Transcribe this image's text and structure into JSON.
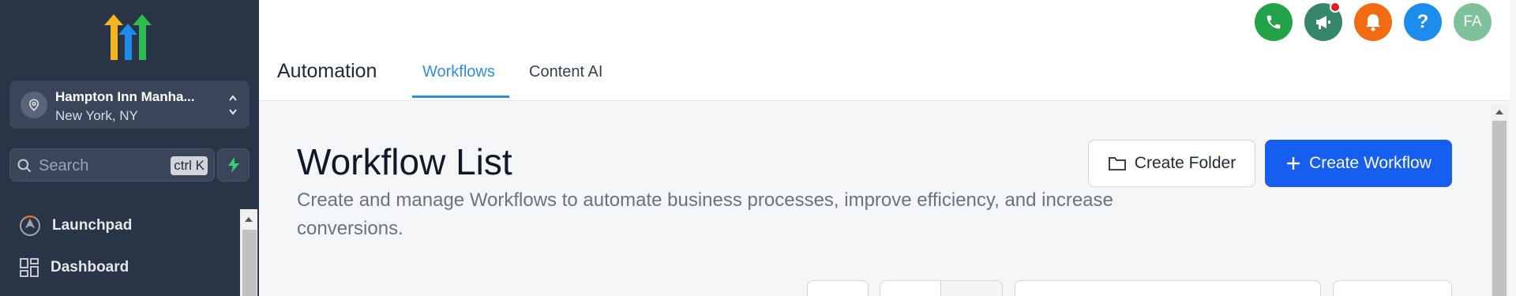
{
  "sidebar": {
    "location": {
      "name": "Hampton Inn Manha...",
      "city": "New York, NY"
    },
    "search": {
      "placeholder": "Search",
      "shortcut": "ctrl K"
    },
    "nav": [
      {
        "label": "Launchpad",
        "icon": "rocket-icon"
      },
      {
        "label": "Dashboard",
        "icon": "grid-icon"
      }
    ]
  },
  "header": {
    "app_title": "Automation",
    "tabs": [
      {
        "label": "Workflows",
        "active": true
      },
      {
        "label": "Content AI",
        "active": false
      }
    ],
    "icons": {
      "phone": "phone-icon",
      "announcements": "megaphone-icon",
      "notifications": "bell-icon",
      "help": "?",
      "avatar": "FA"
    }
  },
  "main": {
    "title": "Workflow List",
    "description": "Create and manage Workflows to automate business processes, improve efficiency, and increase conversions.",
    "buttons": {
      "create_folder": "Create Folder",
      "create_workflow": "Create Workflow"
    }
  },
  "colors": {
    "sidebar_bg": "#2a3447",
    "accent": "#2f8ee0",
    "primary_button": "#155eef"
  }
}
